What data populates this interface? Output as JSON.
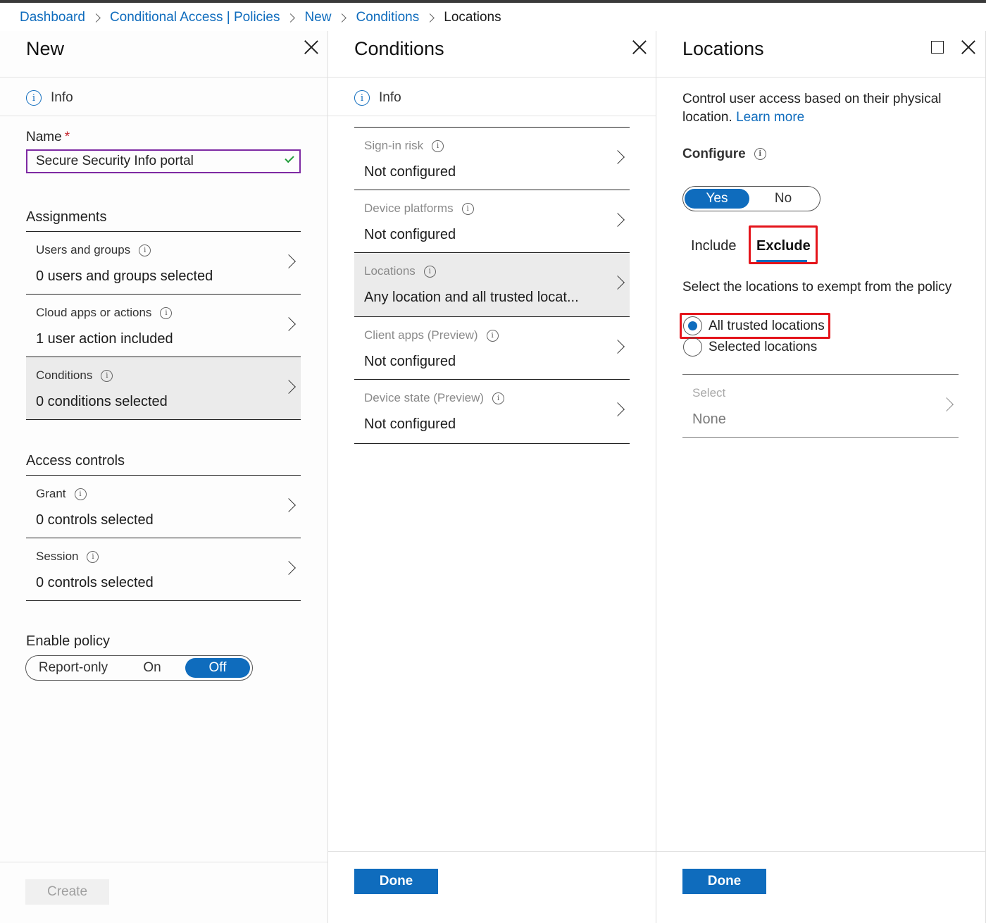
{
  "breadcrumb": [
    {
      "label": "Dashboard"
    },
    {
      "label": "Conditional Access | Policies"
    },
    {
      "label": "New"
    },
    {
      "label": "Conditions"
    },
    {
      "label": "Locations"
    }
  ],
  "new_panel": {
    "title": "New",
    "info": "Info",
    "name_label": "Name",
    "name_required": "*",
    "name_value": "Secure Security Info portal",
    "assignments_heading": "Assignments",
    "assignments": [
      {
        "title": "Users and groups",
        "value": "0 users and groups selected"
      },
      {
        "title": "Cloud apps or actions",
        "value": "1 user action included"
      },
      {
        "title": "Conditions",
        "value": "0 conditions selected"
      }
    ],
    "access_heading": "Access controls",
    "access": [
      {
        "title": "Grant",
        "value": "0 controls selected"
      },
      {
        "title": "Session",
        "value": "0 controls selected"
      }
    ],
    "enable_heading": "Enable policy",
    "enable_options": [
      "Report-only",
      "On",
      "Off"
    ],
    "enable_selected": "Off",
    "create_label": "Create"
  },
  "conditions_panel": {
    "title": "Conditions",
    "info": "Info",
    "items": [
      {
        "title": "Sign-in risk",
        "value": "Not configured"
      },
      {
        "title": "Device platforms",
        "value": "Not configured"
      },
      {
        "title": "Locations",
        "value": "Any location and all trusted locat..."
      },
      {
        "title": "Client apps (Preview)",
        "value": "Not configured"
      },
      {
        "title": "Device state (Preview)",
        "value": "Not configured"
      }
    ],
    "done_label": "Done"
  },
  "locations_panel": {
    "title": "Locations",
    "description": "Control user access based on their physical location.",
    "learn_more": "Learn more",
    "configure_label": "Configure",
    "configure_options": [
      "Yes",
      "No"
    ],
    "configure_selected": "Yes",
    "tabs": [
      "Include",
      "Exclude"
    ],
    "active_tab": "Exclude",
    "exempt_text": "Select the locations to exempt from the policy",
    "radio_options": [
      "All trusted locations",
      "Selected locations"
    ],
    "radio_selected": "All trusted locations",
    "select_title": "Select",
    "select_value": "None",
    "done_label": "Done"
  },
  "colors": {
    "accent": "#0f6cbd",
    "highlight": "#e4141b",
    "input_border": "#7e2aa3",
    "valid_check": "#1f9c38"
  }
}
